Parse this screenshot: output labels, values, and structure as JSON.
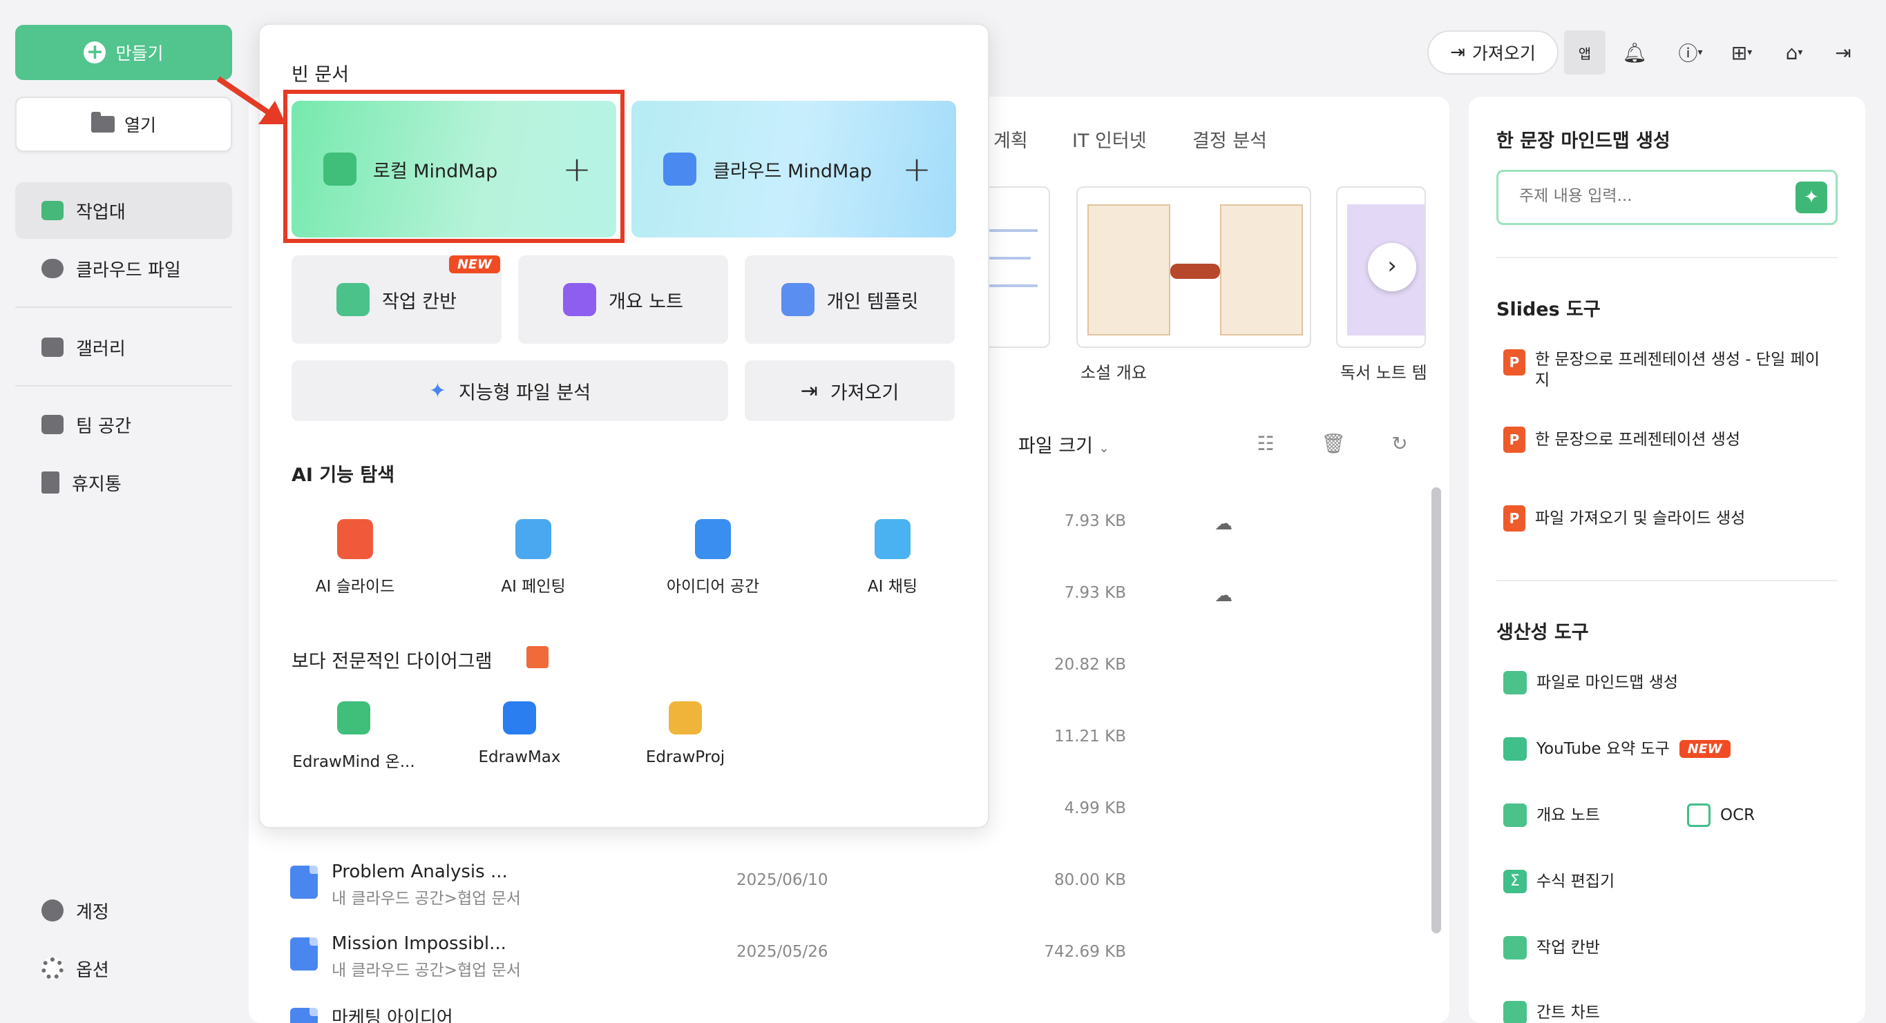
{
  "sidebar": {
    "create_label": "만들기",
    "open_label": "열기",
    "items": [
      {
        "label": "작업대"
      },
      {
        "label": "클라우드 파일"
      },
      {
        "label": "갤러리"
      },
      {
        "label": "팀 공간"
      },
      {
        "label": "휴지통"
      }
    ],
    "account_label": "계정",
    "options_label": "옵션"
  },
  "topbar": {
    "import_label": "가져오기",
    "app_label": "앱"
  },
  "templates": {
    "tabs": [
      "계획",
      "IT 인터넷",
      "결정 분석"
    ],
    "cards": [
      {
        "label": ""
      },
      {
        "label": "소설 개요"
      },
      {
        "label": "독서 노트 템"
      }
    ]
  },
  "file_table": {
    "size_header": "파일 크기",
    "sizes_top": [
      "7.93 KB",
      "7.93 KB",
      "20.82 KB",
      "11.21 KB",
      "4.99 KB"
    ],
    "rows": [
      {
        "name": "Problem Analysis ...",
        "path": "내 클라우드 공간>협업 문서",
        "date": "2025/06/10",
        "size": "80.00 KB"
      },
      {
        "name": "Mission Impossibl...",
        "path": "내 클라우드 공간>협업 문서",
        "date": "2025/05/26",
        "size": "742.69 KB"
      },
      {
        "name": "마케팅 아이디어",
        "path": "",
        "date": "",
        "size": ""
      }
    ]
  },
  "popup": {
    "blank_title": "빈 문서",
    "local_mindmap": "로컬 MindMap",
    "cloud_mindmap": "클라우드 MindMap",
    "kanban": "작업 칸반",
    "new_badge": "NEW",
    "outline_note": "개요 노트",
    "personal_template": "개인 템플릿",
    "smart_analysis": "지능형 파일 분석",
    "import": "가져오기",
    "ai_title": "AI 기능 탐색",
    "ai_items": [
      {
        "label": "AI 슬라이드"
      },
      {
        "label": "AI 페인팅"
      },
      {
        "label": "아이디어 공간"
      },
      {
        "label": "AI 채팅"
      }
    ],
    "pro_title": "보다 전문적인 다이어그램",
    "pro_items": [
      {
        "label": "EdrawMind 온..."
      },
      {
        "label": "EdrawMax"
      },
      {
        "label": "EdrawProj"
      }
    ]
  },
  "right_panel": {
    "one_sentence_title": "한 문장 마인드맵 생성",
    "topic_placeholder": "주제 내용 입력...",
    "slides_title": "Slides 도구",
    "slides_items": [
      {
        "label": "한 문장으로 프레젠테이션 생성 - 단일 페이지"
      },
      {
        "label": "한 문장으로 프레젠테이션 생성"
      },
      {
        "label": "파일 가져오기 및 슬라이드 생성"
      }
    ],
    "productivity_title": "생산성 도구",
    "tools": {
      "file_to_mindmap": "파일로 마인드맵 생성",
      "youtube": "YouTube 요약 도구",
      "youtube_badge": "NEW",
      "outline": "개요 노트",
      "ocr": "OCR",
      "formula": "수식 편집기",
      "kanban": "작업 칸반",
      "gantt": "간트 차트"
    }
  },
  "colors": {
    "accent_green": "#52c48e",
    "highlight_red": "#e53b25"
  }
}
